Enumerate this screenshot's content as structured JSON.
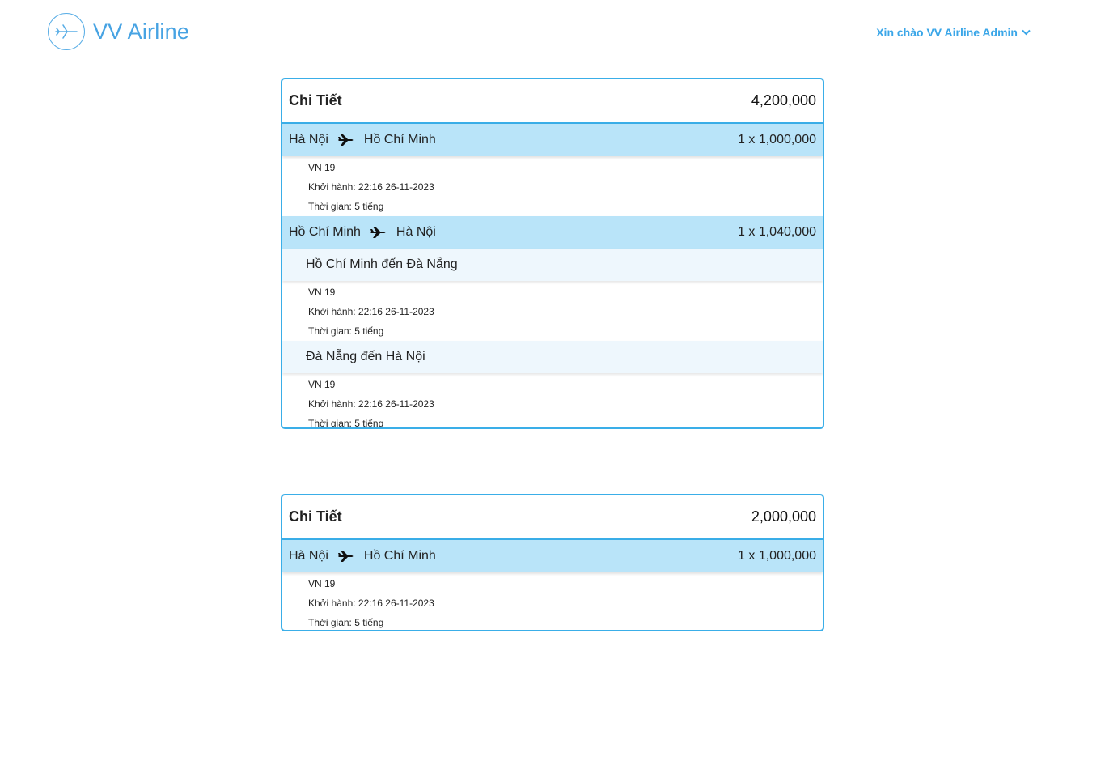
{
  "brand": {
    "name": "VV Airline",
    "icon": "plane-icon"
  },
  "user_menu": {
    "greeting": "Xin chào VV Airline Admin",
    "icon": "chevron-down-icon"
  },
  "bookings": [
    {
      "title": "Chi Tiết",
      "total": "4,200,000",
      "legs": [
        {
          "from": "Hà Nội",
          "to": "Hồ Chí Minh",
          "price": "1 x 1,000,000",
          "details": {
            "flight": "VN 19",
            "departure": "Khởi hành: 22:16 26-11-2023",
            "duration": "Thời gian: 5 tiếng"
          }
        },
        {
          "from": "Hồ Chí Minh",
          "to": "Hà Nội",
          "price": "1 x 1,040,000",
          "segments": [
            {
              "label": "Hồ Chí Minh đến Đà Nẵng",
              "flight": "VN 19",
              "departure": "Khởi hành: 22:16 26-11-2023",
              "duration": "Thời gian: 5 tiếng"
            },
            {
              "label": "Đà Nẵng đến Hà Nội",
              "flight": "VN 19",
              "departure": "Khởi hành: 22:16 26-11-2023",
              "duration": "Thời gian: 5 tiếng"
            }
          ]
        }
      ]
    },
    {
      "title": "Chi Tiết",
      "total": "2,000,000",
      "legs": [
        {
          "from": "Hà Nội",
          "to": "Hồ Chí Minh",
          "price": "1 x 1,000,000",
          "details": {
            "flight": "VN 19",
            "departure": "Khởi hành: 22:16 26-11-2023",
            "duration": "Thời gian: 5 tiếng"
          }
        }
      ]
    }
  ]
}
